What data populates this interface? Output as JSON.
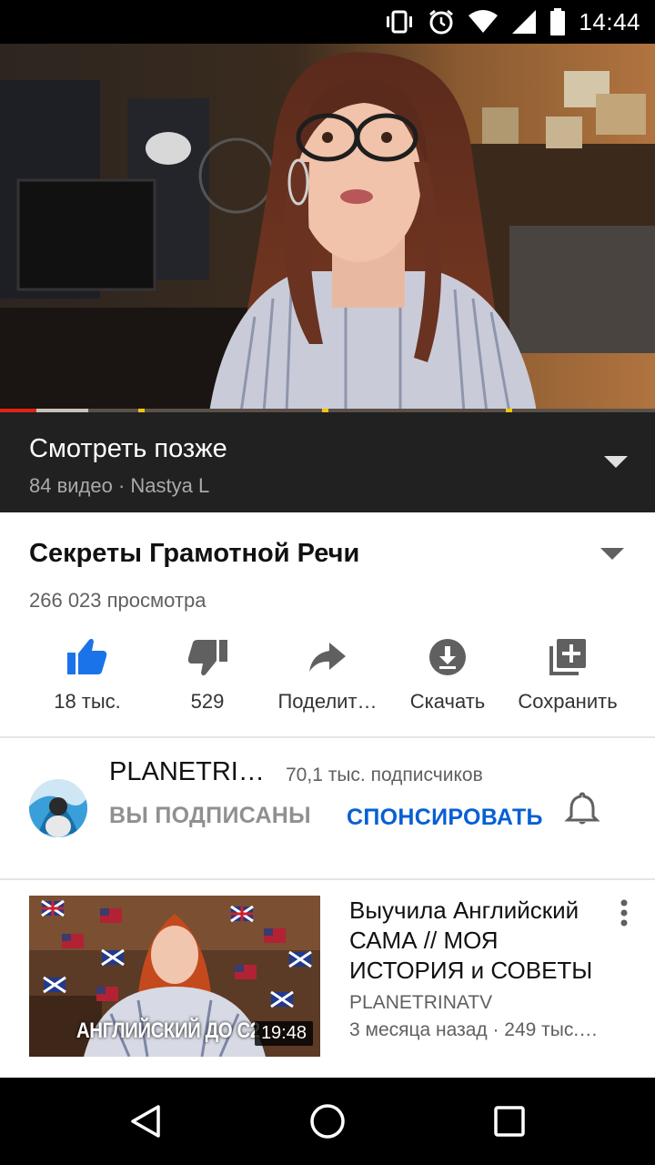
{
  "status_bar": {
    "time": "14:44",
    "icons": [
      "vibrate-icon",
      "alarm-icon",
      "wifi-icon",
      "signal-icon",
      "battery-icon"
    ]
  },
  "player": {
    "progress_played": 0.055,
    "progress_buffered": 0.135
  },
  "playlist": {
    "title": "Смотреть позже",
    "meta": "84 видео · Nastya L"
  },
  "video": {
    "title": "Секреты Грамотной Речи",
    "views": "266 023 просмотра"
  },
  "actions": {
    "like": "18 тыс.",
    "dislike": "529",
    "share": "Поделит…",
    "download": "Скачать",
    "save": "Сохранить"
  },
  "channel": {
    "name": "PLANETRI…",
    "subscribers": "70,1 тыс. подписчиков",
    "subscribed": "ВЫ ПОДПИСАНЫ",
    "sponsor": "СПОНСИРОВАТЬ"
  },
  "recommended": [
    {
      "title": "Выучила Английский САМА // МОЯ ИСТОРИЯ и СОВЕТЫ",
      "channel": "PLANETRINATV",
      "meta": "3 месяца назад · 249 тыс.…",
      "duration": "19:48",
      "thumb_caption": "АНГЛИЙСКИЙ ДО С2"
    }
  ],
  "colors": {
    "accent_blue": "#065fd4",
    "like_active": "#1a73e8",
    "progress_red": "#e32216",
    "playlist_bg": "#212121"
  }
}
